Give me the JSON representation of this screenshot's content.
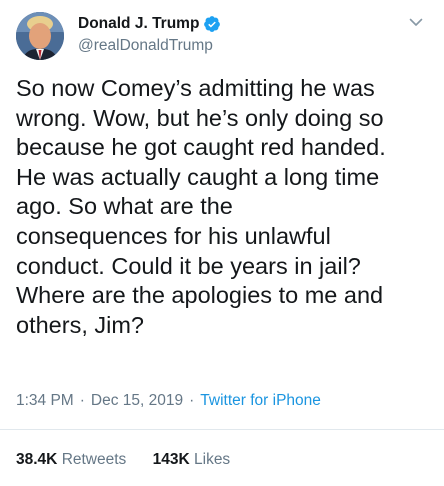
{
  "account": {
    "display_name": "Donald J. Trump",
    "handle": "@realDonaldTrump",
    "verified_icon": "verified-badge-icon",
    "avatar_icon": "profile-avatar-icon"
  },
  "tweet": {
    "text": "So now Comey’s admitting he was\nwrong. Wow, but he’s only doing so\nbecause he got caught red handed.\nHe was actually caught a long time\nago. So what are the\nconsequences for his unlawful\nconduct. Could it be years in jail?\nWhere are the apologies to me and\nothers, Jim?",
    "time": "1:34 PM",
    "separator": "·",
    "date": "Dec 15, 2019",
    "source": "Twitter for iPhone"
  },
  "stats": {
    "retweets_count": "38.4K",
    "retweets_label": "Retweets",
    "likes_count": "143K",
    "likes_label": "Likes"
  },
  "colors": {
    "text": "#14171a",
    "secondary": "#657786",
    "link": "#1b95e0",
    "verified": "#1da1f2",
    "divider": "#e1e8ed"
  }
}
